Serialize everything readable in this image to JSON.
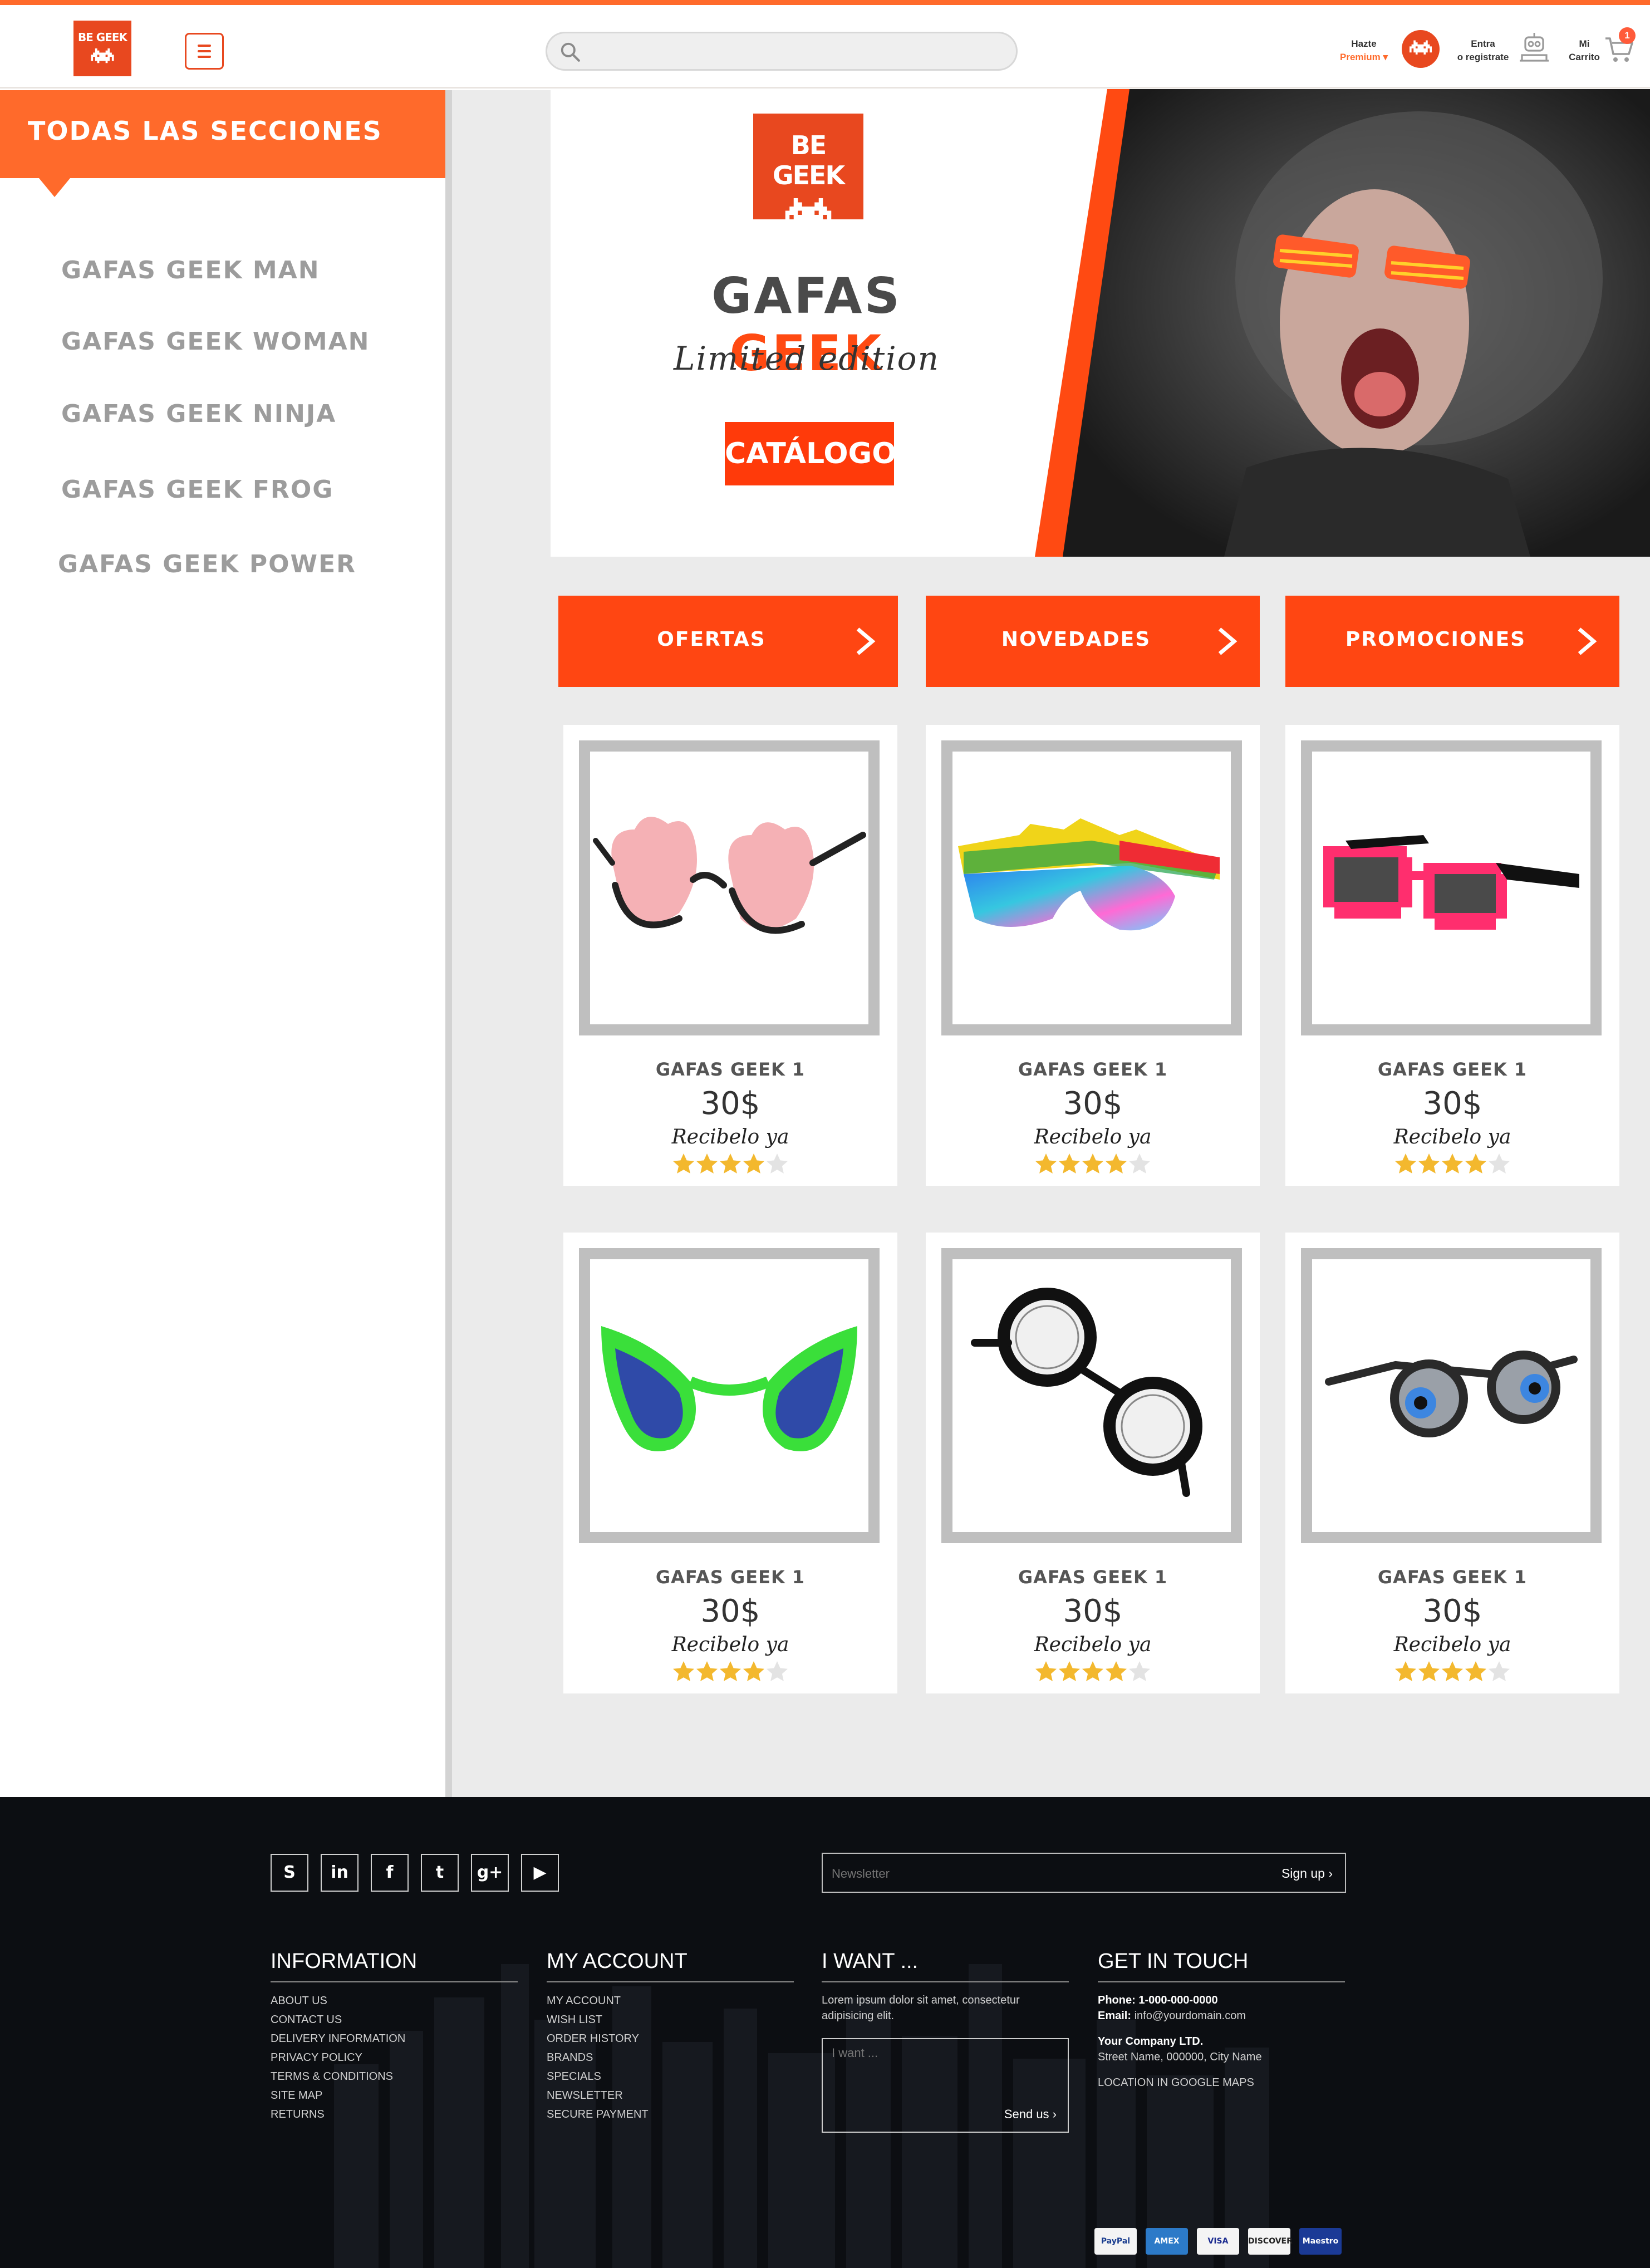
{
  "header": {
    "logo_text": "BE GEEK",
    "search_placeholder": "",
    "premium_line1": "Hazte",
    "premium_line2": "Premium ▾",
    "login_line1": "Entra",
    "login_line2": "o registrate",
    "cart_line1": "Mi",
    "cart_line2": "Carrito",
    "cart_count": "1",
    "icons": [
      "menu-icon",
      "search-icon",
      "invader-icon",
      "robot-icon",
      "cart-icon"
    ]
  },
  "sidebar": {
    "title": "TODAS LAS SECCIONES",
    "items": [
      {
        "label": "GAFAS GEEK MAN"
      },
      {
        "label": "GAFAS GEEK WOMAN"
      },
      {
        "label": "GAFAS GEEK NINJA"
      },
      {
        "label": "GAFAS GEEK FROG"
      },
      {
        "label": "GAFAS GEEK POWER"
      }
    ]
  },
  "banner": {
    "logo_text": "BE GEEK",
    "title_part1": "GAFAS",
    "title_part2": "GEEK",
    "subtitle": "Limited edition",
    "button": "CATÁLOGO"
  },
  "categories": [
    {
      "label": "OFERTAS"
    },
    {
      "label": "NOVEDADES"
    },
    {
      "label": "PROMOCIONES"
    }
  ],
  "products": [
    {
      "name": "GAFAS GEEK 1",
      "price": "30$",
      "delivery": "Recibelo ya",
      "rating": 4,
      "rating_max": 5,
      "image": "pink-cloud-glasses"
    },
    {
      "name": "GAFAS GEEK 1",
      "price": "30$",
      "delivery": "Recibelo ya",
      "rating": 4,
      "rating_max": 5,
      "image": "rainbow-shield-glasses"
    },
    {
      "name": "GAFAS GEEK 1",
      "price": "30$",
      "delivery": "Recibelo ya",
      "rating": 4,
      "rating_max": 5,
      "image": "pixel-pink-glasses"
    },
    {
      "name": "GAFAS GEEK 1",
      "price": "30$",
      "delivery": "Recibelo ya",
      "rating": 4,
      "rating_max": 5,
      "image": "green-alien-glasses"
    },
    {
      "name": "GAFAS GEEK 1",
      "price": "30$",
      "delivery": "Recibelo ya",
      "rating": 4,
      "rating_max": 5,
      "image": "round-black-glasses"
    },
    {
      "name": "GAFAS GEEK 1",
      "price": "30$",
      "delivery": "Recibelo ya",
      "rating": 4,
      "rating_max": 5,
      "image": "eyeball-glasses"
    }
  ],
  "footer": {
    "social": [
      {
        "name": "skype-icon",
        "glyph": "S"
      },
      {
        "name": "linkedin-icon",
        "glyph": "in"
      },
      {
        "name": "facebook-icon",
        "glyph": "f"
      },
      {
        "name": "twitter-icon",
        "glyph": "t"
      },
      {
        "name": "googleplus-icon",
        "glyph": "g+"
      },
      {
        "name": "youtube-icon",
        "glyph": "▶"
      }
    ],
    "newsletter_placeholder": "Newsletter",
    "signup": "Sign up ›",
    "information": {
      "title": "INFORMATION",
      "links": [
        "ABOUT US",
        "CONTACT US",
        "DELIVERY INFORMATION",
        "PRIVACY POLICY",
        "TERMS & CONDITIONS",
        "SITE MAP",
        "RETURNS"
      ]
    },
    "my_account": {
      "title": "MY ACCOUNT",
      "links": [
        "MY ACCOUNT",
        "WISH LIST",
        "ORDER HISTORY",
        "BRANDS",
        "SPECIALS",
        "NEWSLETTER",
        "SECURE PAYMENT"
      ]
    },
    "i_want": {
      "title": "I WANT ...",
      "text": "Lorem ipsum dolor sit amet, consectetur adipisicing elit.",
      "placeholder": "I want ...",
      "send": "Send us ›"
    },
    "contact": {
      "title": "GET IN TOUCH",
      "phone_label": "Phone:",
      "phone": "1-000-000-0000",
      "email_label": "Email:",
      "email": "info@yourdomain.com",
      "company": "Your Company LTD.",
      "address": "Street Name, 000000, City Name",
      "maps": "LOCATION IN GOOGLE MAPS"
    },
    "payments": [
      {
        "label": "PayPal",
        "bg": "#f4f4f4",
        "fg": "#1a3d8f"
      },
      {
        "label": "AMEX",
        "bg": "#2c7ac8",
        "fg": "#ffffff"
      },
      {
        "label": "VISA",
        "bg": "#f4f4f4",
        "fg": "#1a2a8f"
      },
      {
        "label": "DISCOVER",
        "bg": "#f4f4f4",
        "fg": "#222222"
      },
      {
        "label": "Maestro",
        "bg": "#1b3a96",
        "fg": "#ffffff"
      }
    ]
  },
  "colors": {
    "accent": "#ff6a2b",
    "accent_dark": "#e8481f",
    "button_orange": "#ff4612",
    "sidebar_text": "#9c9c9c",
    "star": "#f3b82e",
    "footer_bg": "#0c0e12"
  }
}
